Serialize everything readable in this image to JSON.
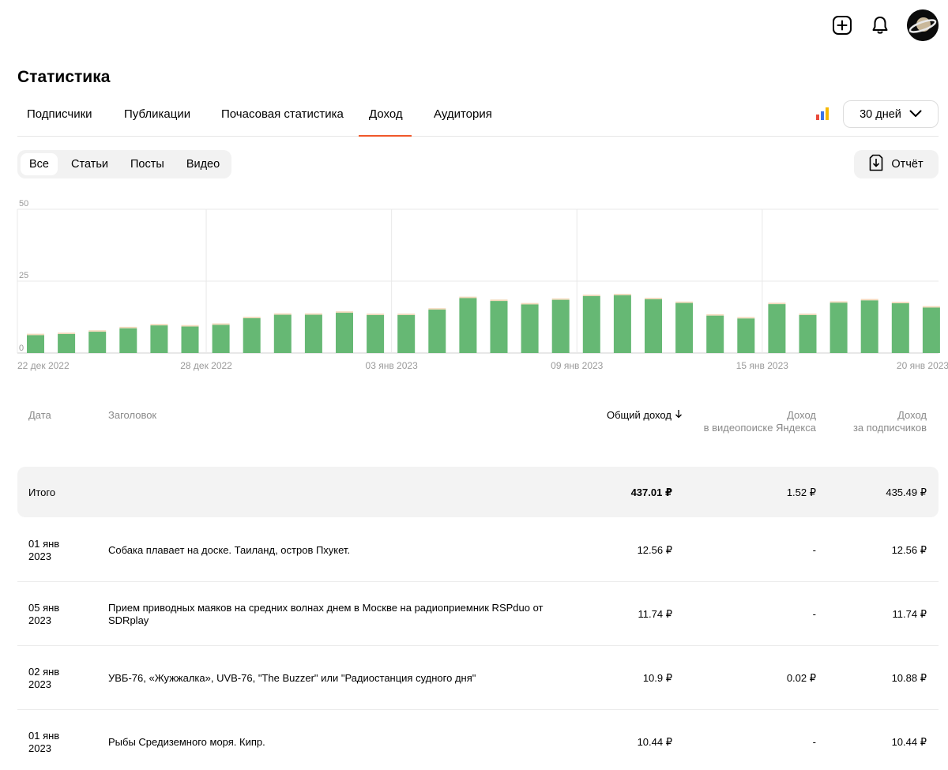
{
  "header": {
    "icons": [
      "plus-square-icon",
      "bell-icon",
      "avatar"
    ],
    "page_title": "Статистика"
  },
  "tabs": [
    {
      "label": "Подписчики",
      "active": false
    },
    {
      "label": "Публикации",
      "active": false
    },
    {
      "label": "Почасовая статистика",
      "active": false
    },
    {
      "label": "Доход",
      "active": true
    },
    {
      "label": "Аудитория",
      "active": false
    }
  ],
  "accent_color": "#f0582a",
  "period": {
    "label": "30 дней"
  },
  "subtabs": [
    {
      "label": "Все",
      "active": true
    },
    {
      "label": "Статьи",
      "active": false
    },
    {
      "label": "Посты",
      "active": false
    },
    {
      "label": "Видео",
      "active": false
    }
  ],
  "report_button": {
    "label": "Отчёт"
  },
  "chart_data": {
    "type": "bar",
    "stacked": true,
    "colors": {
      "main": "#66b874",
      "top": "#f3d9bb"
    },
    "ylim": [
      0,
      50
    ],
    "yticks": [
      50,
      25,
      0
    ],
    "xtick_labels": [
      "22 дек 2022",
      "28 дек 2022",
      "03 янв 2023",
      "09 янв 2023",
      "15 янв 2023",
      "20 янв 2023"
    ],
    "xtick_index": [
      0,
      6,
      12,
      18,
      24,
      29
    ],
    "grid": true,
    "categories": [
      "22 дек 2022",
      "23 дек 2022",
      "24 дек 2022",
      "25 дек 2022",
      "26 дек 2022",
      "27 дек 2022",
      "28 дек 2022",
      "29 дек 2022",
      "30 дек 2022",
      "31 дек 2022",
      "01 янв 2023",
      "02 янв 2023",
      "03 янв 2023",
      "04 янв 2023",
      "05 янв 2023",
      "06 янв 2023",
      "07 янв 2023",
      "08 янв 2023",
      "09 янв 2023",
      "10 янв 2023",
      "11 янв 2023",
      "12 янв 2023",
      "13 янв 2023",
      "14 янв 2023",
      "15 янв 2023",
      "16 янв 2023",
      "17 янв 2023",
      "18 янв 2023",
      "19 янв 2023",
      "20 янв 2023"
    ],
    "series": [
      {
        "values": [
          6.2,
          6.6,
          7.4,
          8.6,
          9.6,
          9.2,
          9.8,
          12.1,
          13.3,
          13.3,
          14.0,
          13.2,
          13.2,
          15.1,
          19.1,
          18.1,
          16.9,
          18.5,
          19.8,
          20.1,
          18.7,
          17.4,
          13.0,
          12.0,
          17.0,
          13.2,
          17.5,
          18.3,
          17.3,
          15.8
        ]
      },
      {
        "values": [
          0.5,
          0.5,
          0.5,
          0.5,
          0.5,
          0.5,
          0.5,
          0.5,
          0.5,
          0.5,
          0.5,
          0.5,
          0.5,
          0.5,
          0.5,
          0.5,
          0.5,
          0.5,
          0.5,
          0.5,
          0.5,
          0.5,
          0.5,
          0.5,
          0.5,
          0.5,
          0.5,
          0.5,
          0.5,
          0.5
        ]
      }
    ]
  },
  "table": {
    "headers": {
      "date": "Дата",
      "title": "Заголовок",
      "total": "Общий доход",
      "video_line1": "Доход",
      "video_line2": "в видеопоиске Яндекса",
      "subs_line1": "Доход",
      "subs_line2": "за подписчиков"
    },
    "total_row": {
      "label": "Итого",
      "total": "437.01 ₽",
      "video": "1.52 ₽",
      "subs": "435.49 ₽"
    },
    "rows": [
      {
        "date1": "01 янв",
        "date2": "2023",
        "title1": "Собака плавает на доске. Таиланд, остров Пхукет.",
        "title2": "",
        "total": "12.56 ₽",
        "video": "-",
        "subs": "12.56 ₽"
      },
      {
        "date1": "05 янв",
        "date2": "2023",
        "title1": "Прием приводных маяков на средних волнах днем в Москве на радиоприемник RSPduo от",
        "title2": "SDRplay",
        "total": "11.74 ₽",
        "video": "-",
        "subs": "11.74 ₽"
      },
      {
        "date1": "02 янв",
        "date2": "2023",
        "title1": "УВБ-76, «Жужжалка», UVB-76, \"The Buzzer\" или \"Радиостанция судного дня\"",
        "title2": "",
        "total": "10.9 ₽",
        "video": "0.02 ₽",
        "subs": "10.88 ₽"
      },
      {
        "date1": "01 янв",
        "date2": "2023",
        "title1": "Рыбы Средиземного моря. Кипр.",
        "title2": "",
        "total": "10.44 ₽",
        "video": "-",
        "subs": "10.44 ₽"
      }
    ]
  }
}
